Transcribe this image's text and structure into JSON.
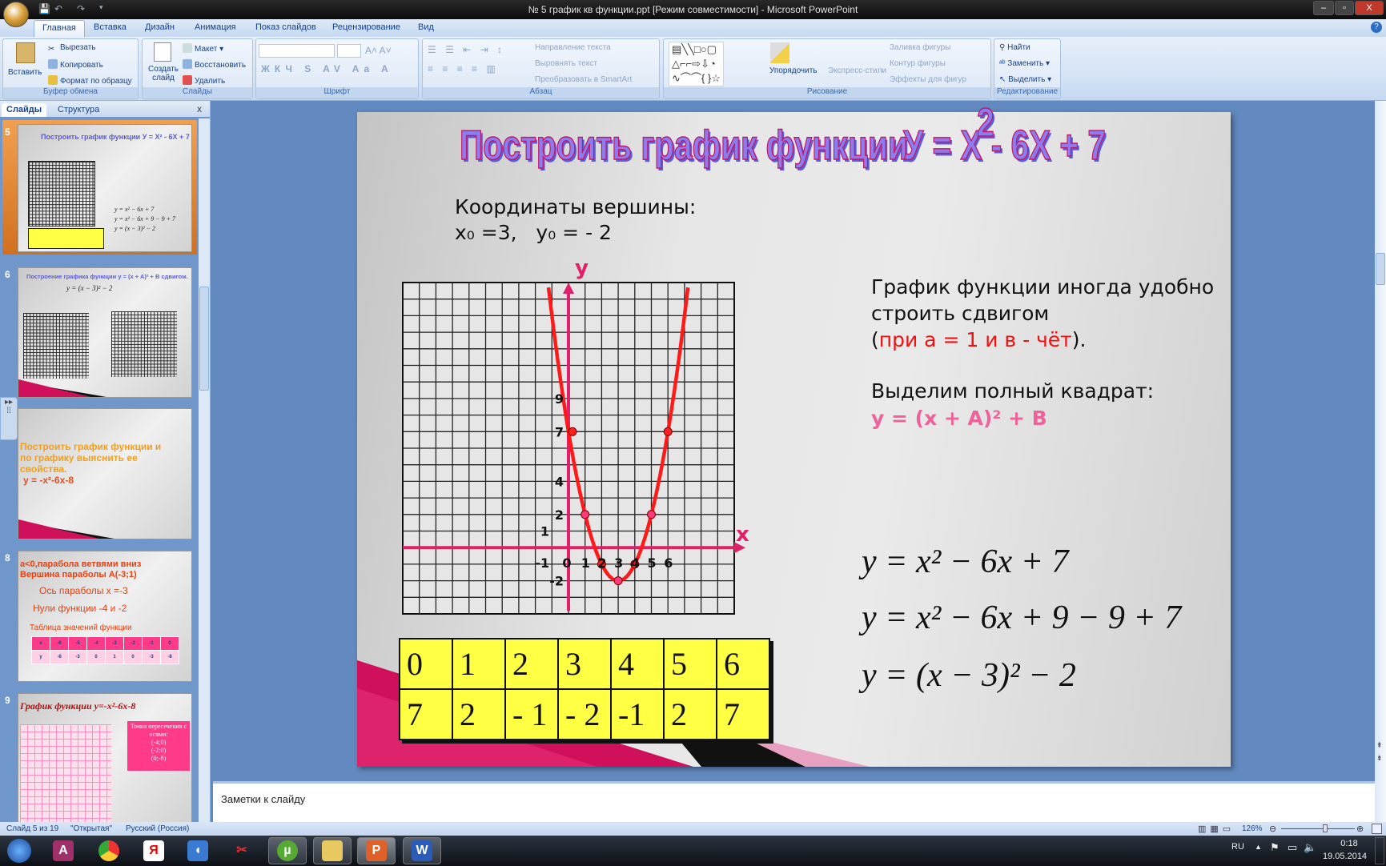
{
  "window": {
    "title": "№ 5 график кв функции.ppt [Режим совместимости] - Microsoft PowerPoint",
    "minimize": "–",
    "maximize": "▫",
    "close": "X"
  },
  "ribbon_tabs": [
    "Главная",
    "Вставка",
    "Дизайн",
    "Анимация",
    "Показ слайдов",
    "Рецензирование",
    "Вид"
  ],
  "ribbon": {
    "clipboard": {
      "label": "Буфер обмена",
      "paste": "Вставить",
      "cut": "Вырезать",
      "copy": "Копировать",
      "format_painter": "Формат по образцу"
    },
    "slides": {
      "label": "Слайды",
      "new_slide": "Создать слайд",
      "layout": "Макет",
      "reset": "Восстановить",
      "delete": "Удалить"
    },
    "font": {
      "label": "Шрифт"
    },
    "paragraph": {
      "label": "Абзац",
      "text_direction": "Направление текста",
      "align_text": "Выровнять текст",
      "convert_smartart": "Преобразовать в SmartArt"
    },
    "drawing": {
      "label": "Рисование",
      "arrange": "Упорядочить",
      "quick_styles": "Экспресс-стили",
      "shape_fill": "Заливка фигуры",
      "shape_outline": "Контур фигуры",
      "shape_effects": "Эффекты для фигур"
    },
    "editing": {
      "label": "Редактирование",
      "find": "Найти",
      "replace": "Заменить",
      "select": "Выделить"
    }
  },
  "left_pane": {
    "tabs": [
      "Слайды",
      "Структура"
    ],
    "close": "x",
    "thumbnails": [
      {
        "num": "5",
        "title": "Построить график функции  У = X² - 6X + 7",
        "selected": true
      },
      {
        "num": "6",
        "title": "Построение графика функции  y = (x + A)² + B  сдвигом.",
        "formula": "y = (x − 3)² − 2"
      },
      {
        "num": "7",
        "lines": [
          "Построить график функции и",
          "по графику выяснить ее",
          "свойства."
        ],
        "formula": "y = -x²-6x-8"
      },
      {
        "num": "8",
        "lines": [
          "a<0,парабола ветвями вниз",
          "Вершина параболы  A(-3;1)"
        ],
        "axis": "Ось параболы x =-3",
        "zeros": "Нули функции -4 и -2",
        "table_title": "Таблица значений функции",
        "table": [
          [
            "x",
            "-6",
            "-5",
            "-4",
            "-3",
            "-2",
            "-1",
            "0"
          ],
          [
            "y",
            "-8",
            "-3",
            "0",
            "1",
            "0",
            "-3",
            "-8"
          ]
        ]
      },
      {
        "num": "9",
        "title": "График функции y=-x²-6x-8",
        "box": [
          "Точки пересечения с осями:",
          "(-4;0)",
          "(-2;0)",
          "(0;-8)"
        ]
      }
    ]
  },
  "slide": {
    "title": "Построить график функции",
    "title_formula": "У = X - 6X + 7",
    "title_exponent": "2",
    "vertex_heading": "Координаты вершины:",
    "vertex_x": "x₀ =3,",
    "vertex_y": "y₀ = - 2",
    "note_line1": "График функции иногда удобно",
    "note_line2": "строить сдвигом",
    "note_open": "(",
    "note_condition": "при а = 1  и   в  - чёт",
    "note_close": ").",
    "square_heading": "Выделим полный квадрат:",
    "square_formula": "y = (x + A)² + B",
    "formulas": [
      "y = x² − 6x + 7",
      "y = x² − 6x + 9 − 9 + 7",
      "y = (x − 3)² − 2"
    ],
    "table": [
      [
        "0",
        "1",
        "2",
        "3",
        "4",
        "5",
        "6"
      ],
      [
        "7",
        "2",
        "- 1",
        "- 2",
        "-1",
        "2",
        "7"
      ]
    ]
  },
  "chart_data": {
    "type": "line",
    "title": "y = x² - 6x + 7",
    "xlabel": "x",
    "ylabel": "y",
    "x": [
      0,
      1,
      2,
      3,
      4,
      5,
      6
    ],
    "y": [
      7,
      2,
      -1,
      -2,
      -1,
      2,
      7
    ],
    "xlim": [
      -10,
      10
    ],
    "ylim": [
      -4,
      16
    ],
    "x_tick_labels": [
      {
        "v": -1,
        "t": "-1"
      },
      {
        "v": 0,
        "t": "0"
      },
      {
        "v": 1,
        "t": "1"
      },
      {
        "v": 2,
        "t": "2"
      },
      {
        "v": 3,
        "t": "3"
      },
      {
        "v": 4,
        "t": "4"
      },
      {
        "v": 5,
        "t": "5"
      },
      {
        "v": 6,
        "t": "6"
      }
    ],
    "y_tick_labels": [
      {
        "v": 9,
        "t": "9"
      },
      {
        "v": 7,
        "t": "7"
      },
      {
        "v": 4,
        "t": "4"
      },
      {
        "v": 2,
        "t": "2"
      },
      {
        "v": 1,
        "t": "1"
      },
      {
        "v": -2,
        "t": "-2"
      }
    ],
    "grid": true,
    "curve_color": "#ff1a1a",
    "axis_color": "#e0206a"
  },
  "notes": {
    "placeholder": "Заметки к слайду"
  },
  "status": {
    "slide": "Слайд 5 из 19",
    "theme": "\"Открытая\"",
    "language": "Русский (Россия)",
    "zoom": "126%",
    "zoom_level": 0.6
  },
  "taskbar": {
    "apps": [
      "start",
      "access",
      "chrome",
      "yandex",
      "sound",
      "snipping",
      "utorrent",
      "explorer",
      "powerpoint",
      "word"
    ],
    "lang": "RU",
    "time": "0:18",
    "date": "19.05.2014"
  }
}
